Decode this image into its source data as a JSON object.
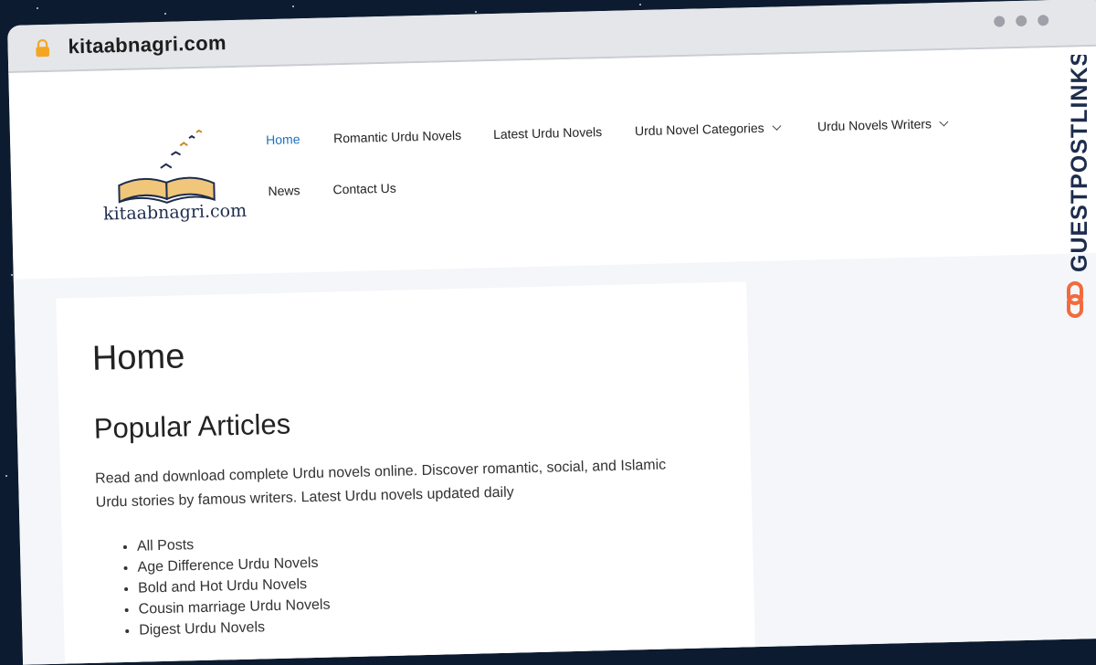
{
  "browser": {
    "url": "kitaabnagri.com"
  },
  "site": {
    "logo_text": "kitaabnagri.com",
    "nav": [
      {
        "label": "Home",
        "active": true,
        "dropdown": false
      },
      {
        "label": "Romantic Urdu Novels",
        "active": false,
        "dropdown": false
      },
      {
        "label": "Latest Urdu Novels",
        "active": false,
        "dropdown": false
      },
      {
        "label": "Urdu Novel Categories",
        "active": false,
        "dropdown": true
      },
      {
        "label": "Urdu Novels Writers",
        "active": false,
        "dropdown": true
      },
      {
        "label": "News",
        "active": false,
        "dropdown": false
      },
      {
        "label": "Contact Us",
        "active": false,
        "dropdown": false
      }
    ]
  },
  "main": {
    "page_title": "Home",
    "section_title": "Popular Articles",
    "intro": "Read and download complete Urdu novels online. Discover romantic, social, and Islamic Urdu stories by famous writers. Latest Urdu novels updated daily",
    "list": [
      "All Posts",
      "Age Difference Urdu Novels",
      "Bold and Hot Urdu Novels",
      "Cousin marriage Urdu Novels",
      "Digest Urdu Novels"
    ]
  },
  "watermark": {
    "text": "GUESTPOSTLINKS"
  },
  "colors": {
    "accent": "#1e73be",
    "brand": "#f26a3d",
    "background": "#0d1b30"
  }
}
